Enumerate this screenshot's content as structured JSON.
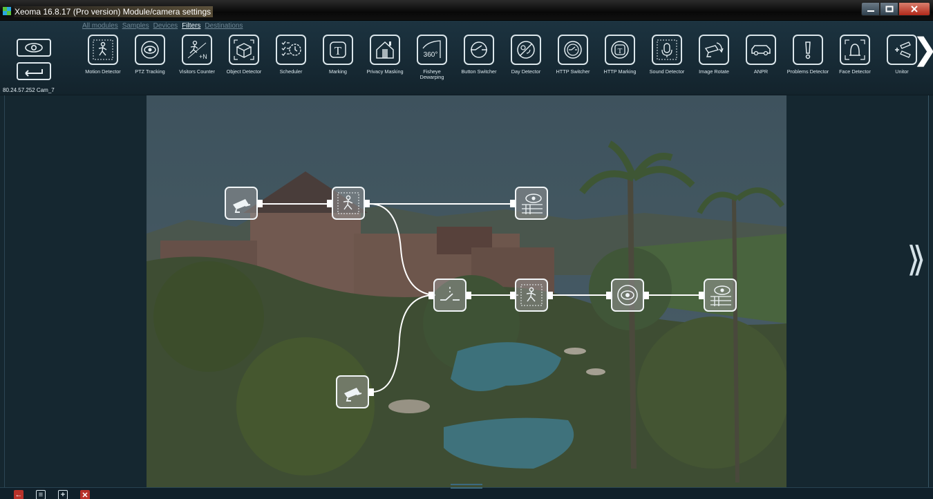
{
  "window": {
    "title": "Xeoma 16.8.17 (Pro version) Module/camera settings"
  },
  "tabs": [
    "All modules",
    "Samples",
    "Devices",
    "Filters",
    "Destinations"
  ],
  "active_tab": "Filters",
  "camera_label": "80.24.57.252 Cam_7",
  "modules": [
    {
      "label": "Motion Detector",
      "icon": "motion-detector-icon"
    },
    {
      "label": "PTZ Tracking",
      "icon": "ptz-tracking-icon"
    },
    {
      "label": "Visitors Counter",
      "icon": "visitors-counter-icon"
    },
    {
      "label": "Object Detector",
      "icon": "object-detector-icon"
    },
    {
      "label": "Scheduler",
      "icon": "scheduler-icon"
    },
    {
      "label": "Marking",
      "icon": "marking-icon"
    },
    {
      "label": "Privacy Masking",
      "icon": "privacy-masking-icon"
    },
    {
      "label": "Fisheye Dewarping",
      "icon": "fisheye-icon"
    },
    {
      "label": "Button Switcher",
      "icon": "button-switcher-icon"
    },
    {
      "label": "Day Detector",
      "icon": "day-detector-icon"
    },
    {
      "label": "HTTP Switcher",
      "icon": "http-switcher-icon"
    },
    {
      "label": "HTTP Marking",
      "icon": "http-marking-icon"
    },
    {
      "label": "Sound Detector",
      "icon": "sound-detector-icon"
    },
    {
      "label": "Image Rotate",
      "icon": "image-rotate-icon"
    },
    {
      "label": "ANPR",
      "icon": "anpr-icon"
    },
    {
      "label": "Problems Detector",
      "icon": "problems-detector-icon"
    },
    {
      "label": "Face Detector",
      "icon": "face-detector-icon"
    },
    {
      "label": "Unitor",
      "icon": "unitor-icon"
    }
  ],
  "fisheye_badge": "360°",
  "marking_glyph": "T",
  "graph_nodes": [
    "camera",
    "motion-detector",
    "preview-archive",
    "switcher",
    "motion-detector",
    "ptz-tracking",
    "preview-archive",
    "camera"
  ],
  "colors": {
    "accent": "#dbe6eb",
    "background": "#15262f",
    "close": "#c0392b"
  }
}
